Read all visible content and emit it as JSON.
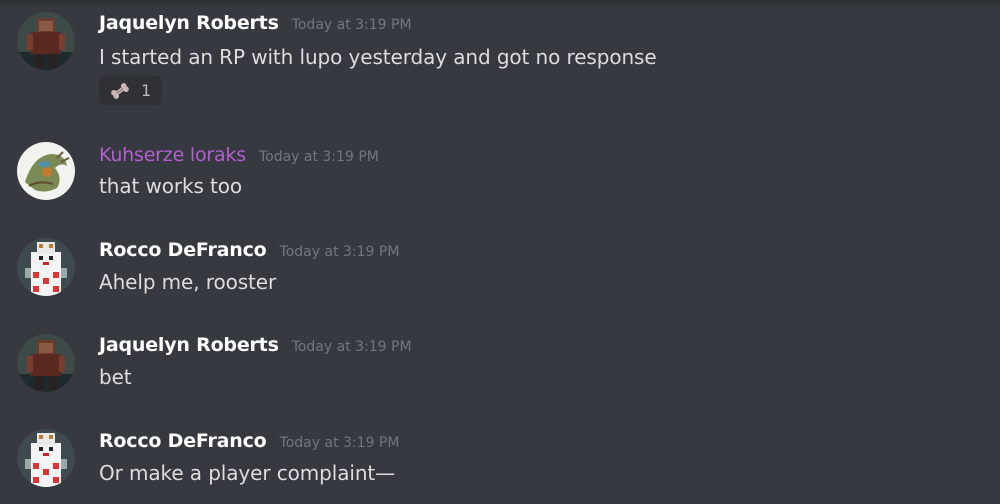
{
  "messages": [
    {
      "author": "Jaquelyn Roberts",
      "timestamp": "Today at 3:19 PM",
      "text": "I started an RP with lupo yesterday and got no response",
      "reaction": {
        "emoji": "bone-emoji",
        "count": "1"
      }
    },
    {
      "author": "Kuhserze loraks",
      "timestamp": "Today at 3:19 PM",
      "text": "that works too",
      "author_color": "#b25fd0"
    },
    {
      "author": "Rocco DeFranco",
      "timestamp": "Today at 3:19 PM",
      "text": "Ahelp me, rooster"
    },
    {
      "author": "Jaquelyn Roberts",
      "timestamp": "Today at 3:19 PM",
      "text": "bet"
    },
    {
      "author": "Rocco DeFranco",
      "timestamp": "Today at 3:19 PM",
      "text": "Or make a player complaint—"
    }
  ],
  "colors": {
    "background": "#36393f",
    "username": "#ffffff",
    "timestamp": "#72767d",
    "text": "#dcddde",
    "reaction_bg": "#2f3136"
  }
}
